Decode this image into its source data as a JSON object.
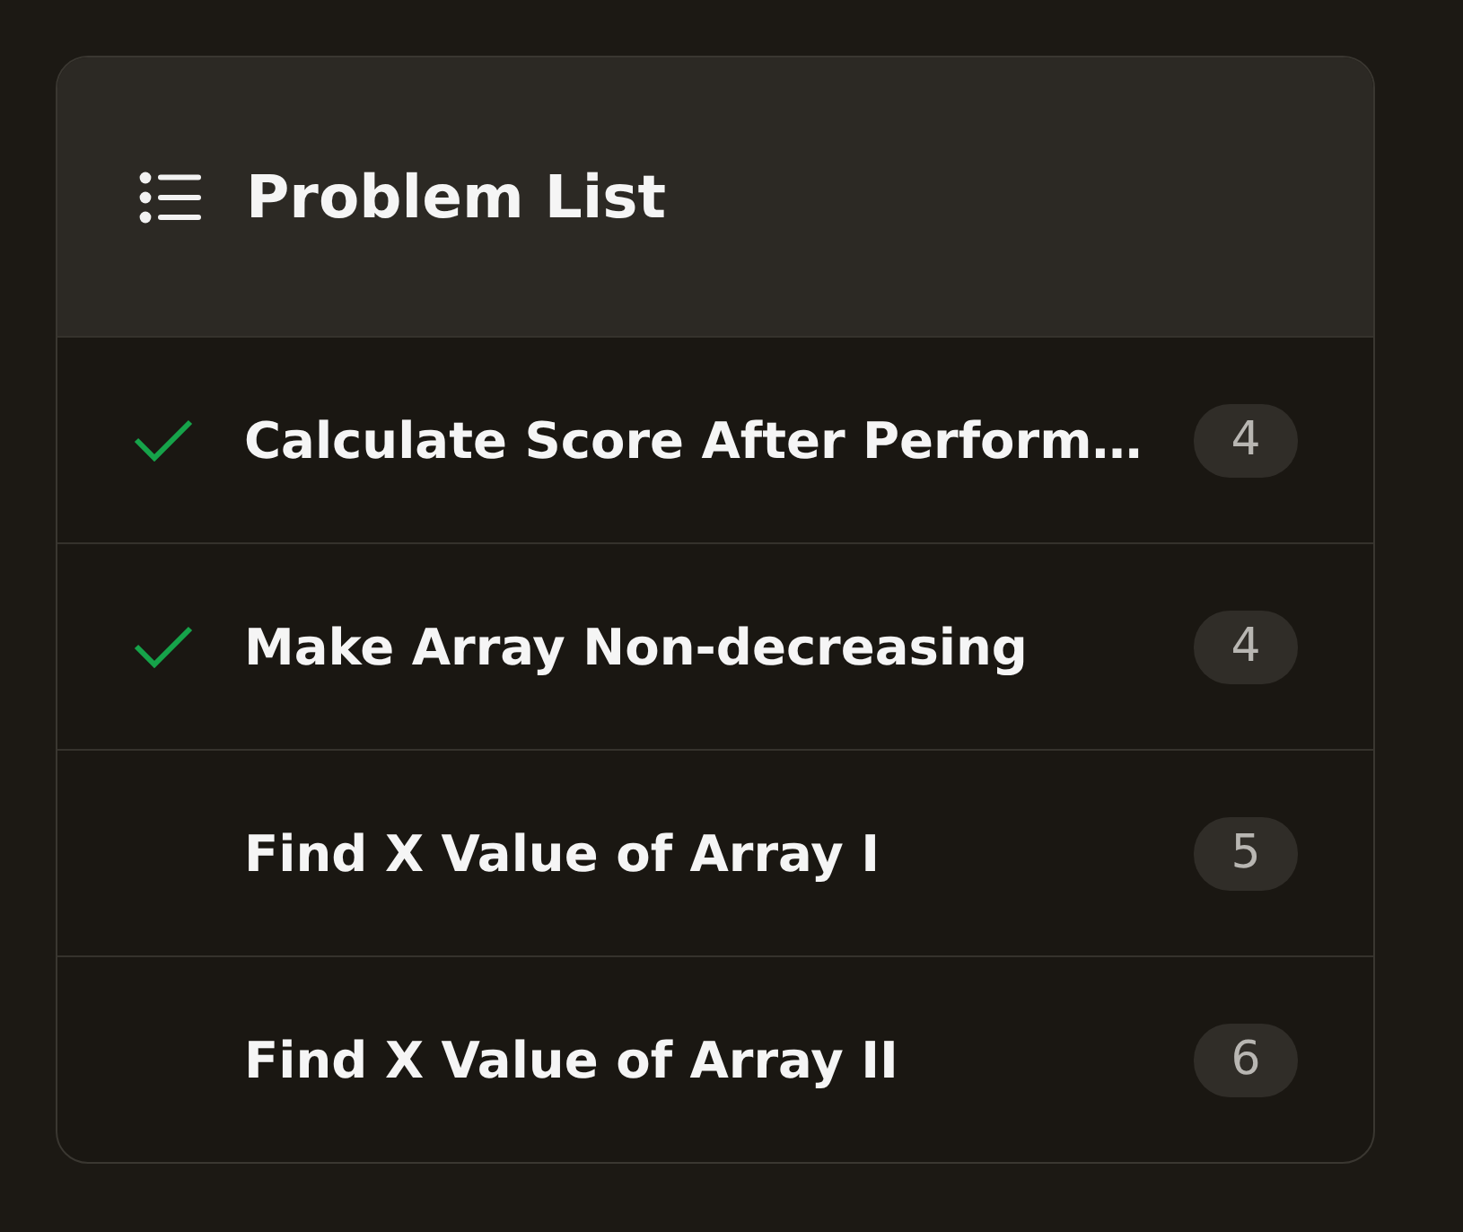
{
  "panel": {
    "title": "Problem List"
  },
  "problems": [
    {
      "title": "Calculate Score After Perform…",
      "solved": true,
      "count": "4"
    },
    {
      "title": "Make Array Non-decreasing",
      "solved": true,
      "count": "4"
    },
    {
      "title": "Find X Value of Array I",
      "solved": false,
      "count": "5"
    },
    {
      "title": "Find X Value of Array II",
      "solved": false,
      "count": "6"
    }
  ]
}
